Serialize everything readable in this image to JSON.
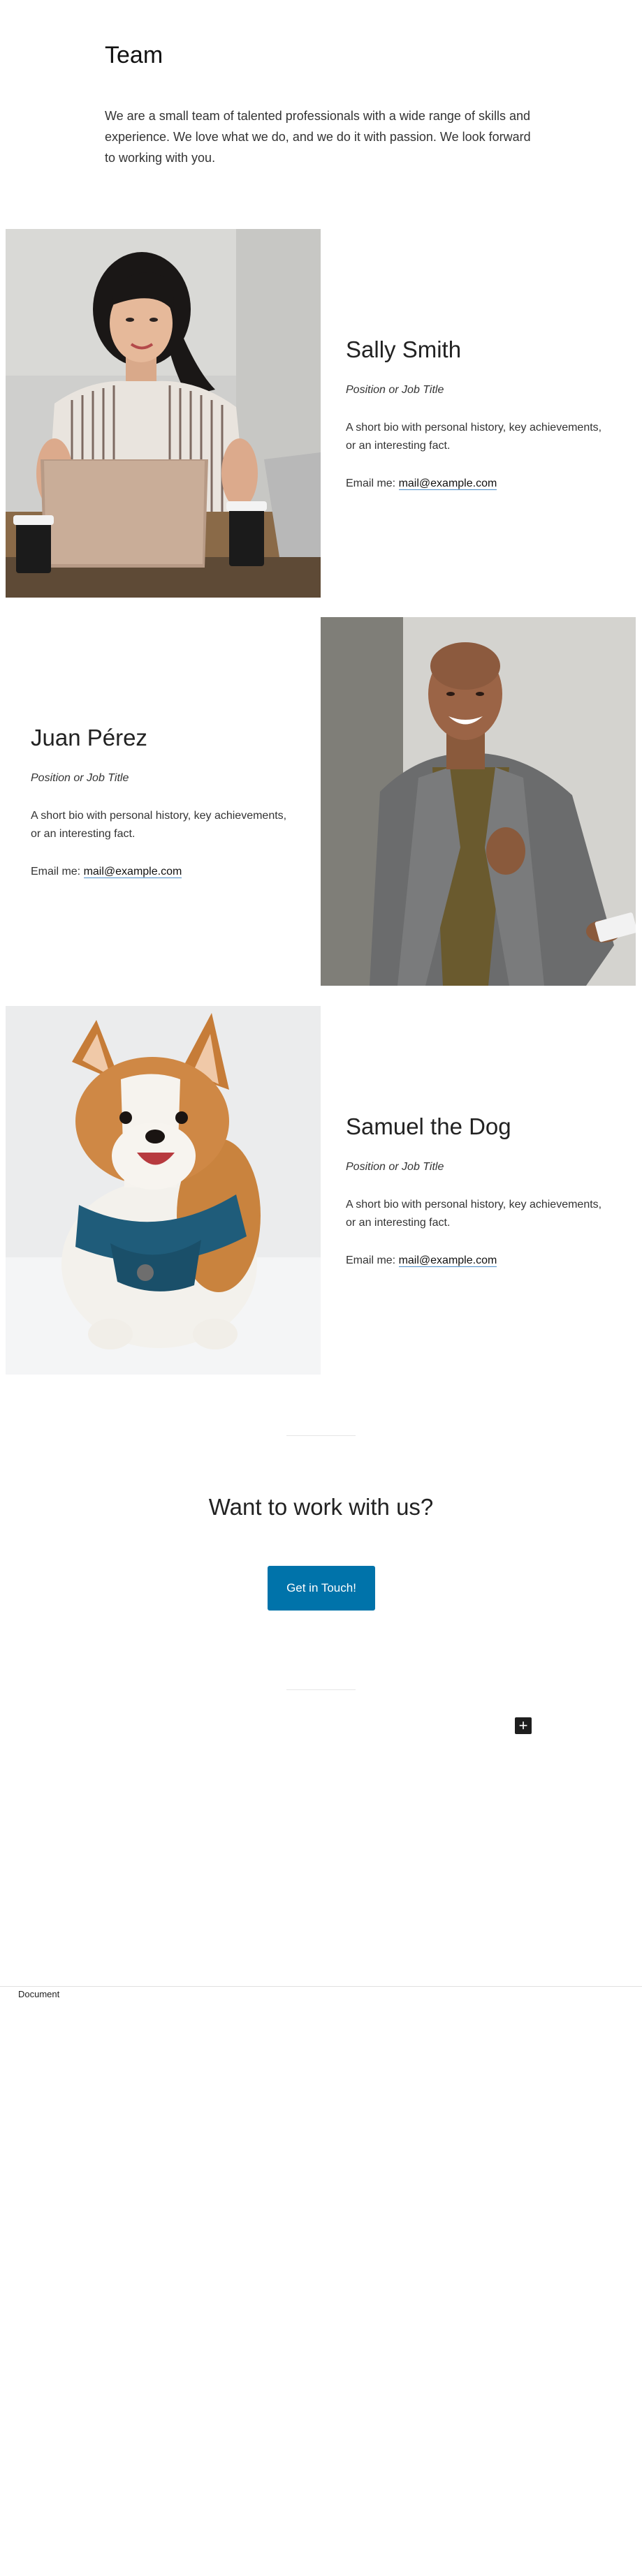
{
  "intro": {
    "heading": "Team",
    "text": "We are a small team of talented professionals with a wide range of skills and experience. We love what we do, and we do it with passion. We look forward to working with you."
  },
  "members": [
    {
      "name": "Sally Smith",
      "role": "Position or Job Title",
      "bio": "A short bio with personal history, key achievements, or an interesting fact.",
      "email_label": "Email me:",
      "email": "mail@example.com",
      "photo": "woman-with-laptop-photo"
    },
    {
      "name": "Juan Pérez",
      "role": "Position or Job Title",
      "bio": "A short bio with personal history, key achievements, or an interesting fact.",
      "email_label": "Email me:",
      "email": "mail@example.com",
      "photo": "smiling-man-in-blazer-photo"
    },
    {
      "name": "Samuel the Dog",
      "role": "Position or Job Title",
      "bio": "A short bio with personal history, key achievements, or an interesting fact.",
      "email_label": "Email me:",
      "email": "mail@example.com",
      "photo": "corgi-in-snow-photo"
    }
  ],
  "cta": {
    "heading": "Want to work with us?",
    "button_label": "Get in Touch!"
  },
  "editor": {
    "add_block_icon": "plus-icon",
    "footer_label": "Document"
  },
  "colors": {
    "button": "#0073aa",
    "link_underline": "#4b8ec9"
  }
}
